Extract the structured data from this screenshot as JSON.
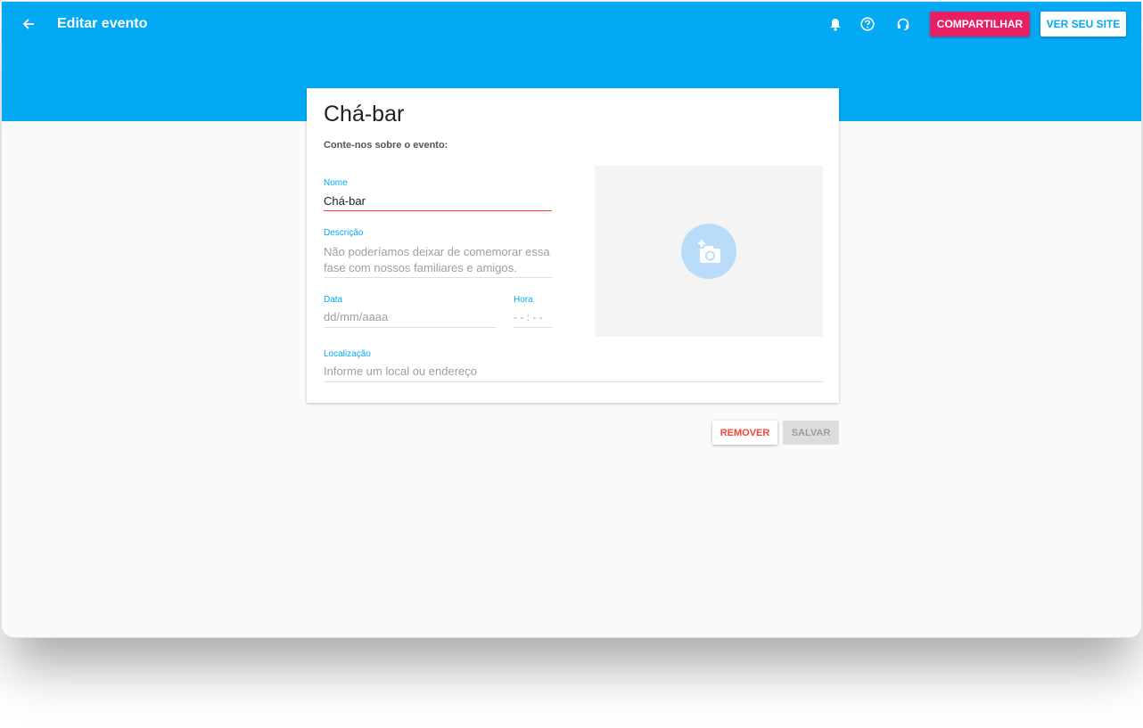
{
  "header": {
    "title": "Editar evento",
    "share_label": "COMPARTILHAR",
    "site_label": "VER SEU SITE",
    "icons": [
      "arrow-back-icon",
      "bell-icon",
      "help-icon",
      "support-icon"
    ]
  },
  "card": {
    "title": "Chá-bar",
    "subtitle": "Conte-nos sobre o evento:",
    "name": {
      "label": "Nome",
      "value": "Chá-bar"
    },
    "description": {
      "label": "Descrição",
      "value": "Não poderíamos deixar de comemorar essa fase com nossos familiares e amigos."
    },
    "date": {
      "label": "Data",
      "placeholder": "dd/mm/aaaa"
    },
    "time": {
      "label": "Hora",
      "placeholder": "- - : - -"
    },
    "location": {
      "label": "Localização",
      "placeholder": "Informe um local ou endereço"
    },
    "photo_icon": "add-photo-icon"
  },
  "actions": {
    "remove_label": "REMOVER",
    "save_label": "SALVAR"
  },
  "colors": {
    "primary": "#03a9f4",
    "accent": "#e91e63",
    "error": "#f44336"
  }
}
